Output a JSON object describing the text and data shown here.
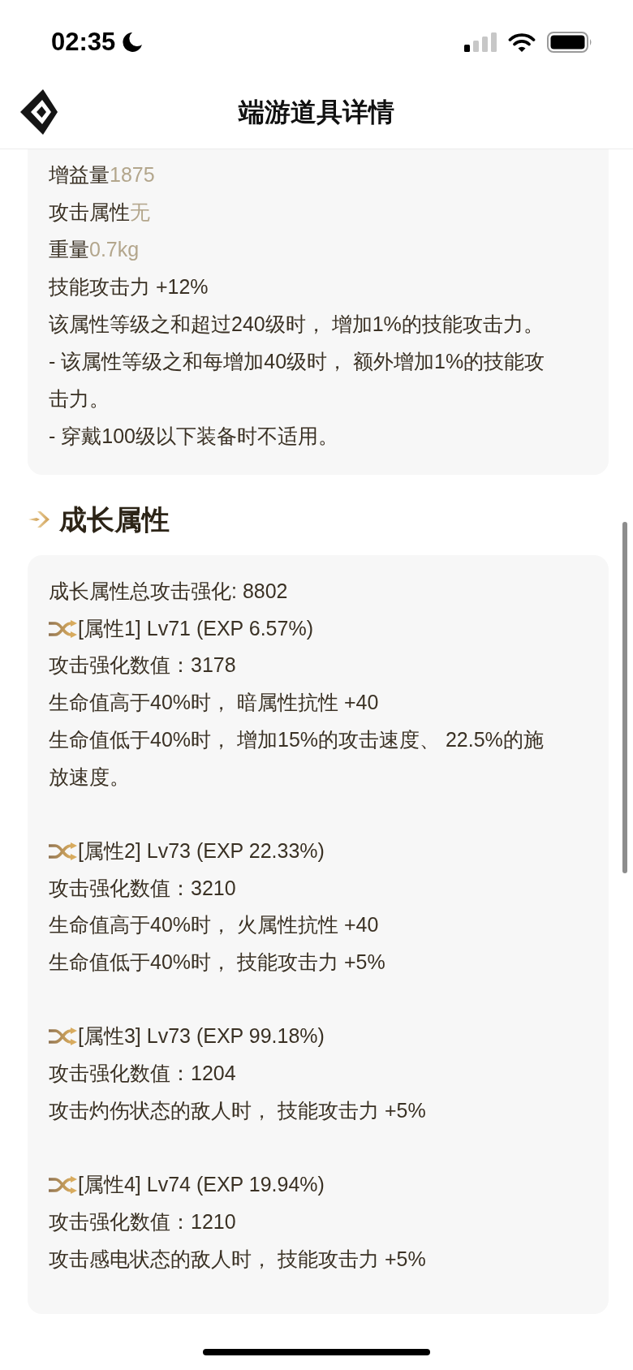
{
  "status_bar": {
    "time": "02:35"
  },
  "header": {
    "title": "端游道具详情"
  },
  "attributes": [
    {
      "kind": "pair",
      "label": "增益量",
      "value": "1875"
    },
    {
      "kind": "pair",
      "label": "攻击属性",
      "value": "无"
    },
    {
      "kind": "pair",
      "label": "重量",
      "value": "0.7kg"
    },
    {
      "kind": "text",
      "text": "技能攻击力 +12%"
    },
    {
      "kind": "text",
      "text": "该属性等级之和超过240级时， 增加1%的技能攻击力。"
    },
    {
      "kind": "text",
      "text": "- 该属性等级之和每增加40级时， 额外增加1%的技能攻击力。"
    },
    {
      "kind": "text",
      "text": "- 穿戴100级以下装备时不适用。"
    }
  ],
  "growth": {
    "title": "成长属性",
    "total": "成长属性总攻击强化: 8802",
    "options": [
      {
        "title": "[属性1] Lv71 (EXP 6.57%)",
        "lines": [
          "攻击强化数值：3178",
          "生命值高于40%时， 暗属性抗性 +40",
          "生命值低于40%时， 增加15%的攻击速度、 22.5%的施放速度。"
        ]
      },
      {
        "title": "[属性2] Lv73 (EXP 22.33%)",
        "lines": [
          "攻击强化数值：3210",
          "生命值高于40%时， 火属性抗性 +40",
          "生命值低于40%时， 技能攻击力 +5%"
        ]
      },
      {
        "title": "[属性3] Lv73 (EXP 99.18%)",
        "lines": [
          "攻击强化数值：1204",
          "攻击灼伤状态的敌人时， 技能攻击力 +5%"
        ]
      },
      {
        "title": "[属性4] Lv74 (EXP 19.94%)",
        "lines": [
          "攻击强化数值：1210",
          "攻击感电状态的敌人时， 技能攻击力 +5%"
        ]
      }
    ]
  }
}
